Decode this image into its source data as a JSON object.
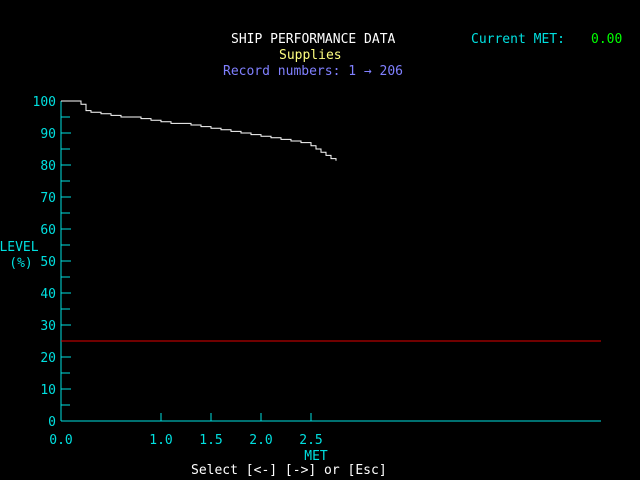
{
  "header": {
    "title": "SHIP PERFORMANCE DATA",
    "subtitle": "Supplies",
    "record_label": "Record numbers: 1 → 206",
    "current_met_label": "Current MET:",
    "current_met_value": "0.00"
  },
  "footer": {
    "instructions": "Select [<-] [->] or [Esc]"
  },
  "colors": {
    "axis": "#00e0e0",
    "title": "#ffffff",
    "subtitle": "#ffff80",
    "record": "#8080ff",
    "met_label": "#00e0e0",
    "met_value": "#00ff00",
    "line": "#ffffff",
    "threshold": "#e00000",
    "background": "#000000"
  },
  "chart_data": {
    "type": "line",
    "title": "SHIP PERFORMANCE DATA",
    "subtitle": "Supplies",
    "xlabel": "MET",
    "ylabel": "LEVEL (%)",
    "xlim": [
      0.0,
      5.4
    ],
    "ylim": [
      0,
      100
    ],
    "x_tick_labels": [
      "0.0",
      "1.0",
      "1.5",
      "2.0",
      "2.5"
    ],
    "x_tick_values": [
      0.0,
      1.0,
      1.5,
      2.0,
      2.5
    ],
    "y_tick_labels": [
      "0",
      "10",
      "20",
      "30",
      "40",
      "50",
      "60",
      "70",
      "80",
      "90",
      "100"
    ],
    "y_tick_values": [
      0,
      10,
      20,
      30,
      40,
      50,
      60,
      70,
      80,
      90,
      100
    ],
    "ylabel_lines": [
      "LEVEL",
      "(%)"
    ],
    "grid": false,
    "series": [
      {
        "step": true,
        "x": [
          0.0,
          0.18,
          0.2,
          0.25,
          0.3,
          0.4,
          0.5,
          0.6,
          0.7,
          0.8,
          0.9,
          1.0,
          1.1,
          1.2,
          1.3,
          1.4,
          1.5,
          1.6,
          1.7,
          1.8,
          1.9,
          2.0,
          2.1,
          2.2,
          2.3,
          2.4,
          2.5,
          2.55,
          2.6,
          2.65,
          2.7,
          2.75
        ],
        "y": [
          100,
          100,
          99,
          97,
          96.5,
          96,
          95.5,
          95,
          95,
          94.5,
          94,
          93.5,
          93,
          93,
          92.5,
          92,
          91.5,
          91,
          90.5,
          90,
          89.5,
          89,
          88.5,
          88,
          87.5,
          87,
          86,
          85,
          84,
          83,
          82,
          81.3
        ]
      }
    ],
    "threshold": {
      "value": 25
    }
  }
}
